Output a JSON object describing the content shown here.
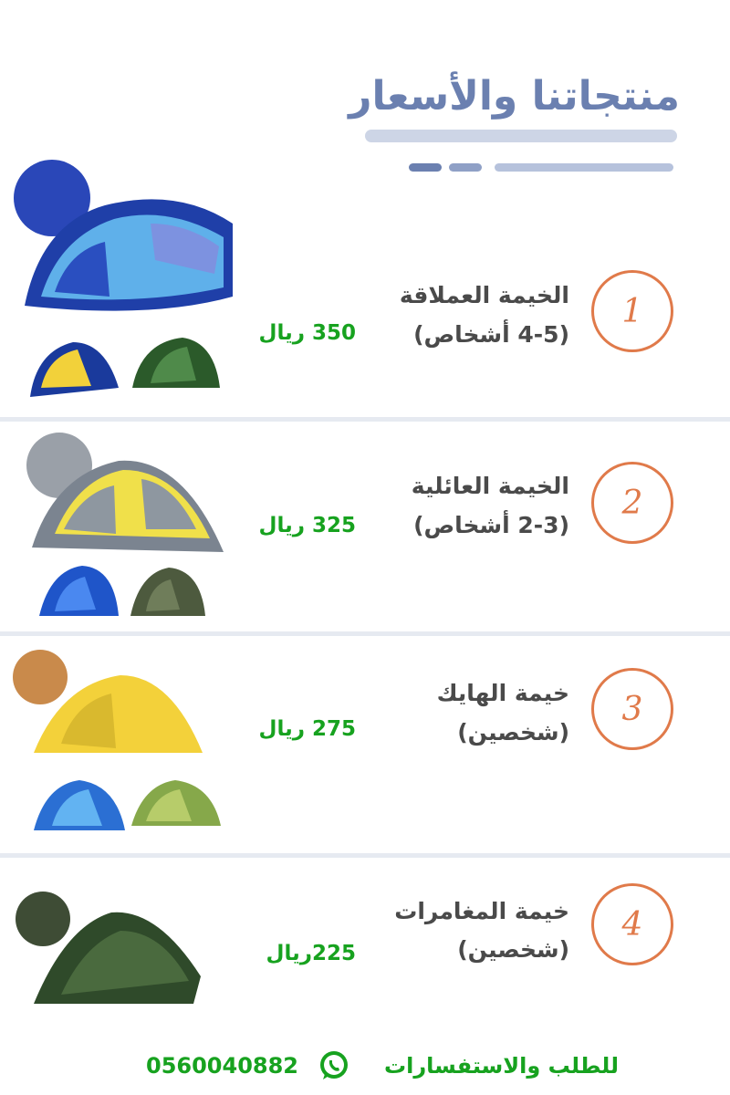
{
  "header": {
    "title": "منتجاتنا والأسعار"
  },
  "products": [
    {
      "number": "1",
      "name": "الخيمة العملاقة",
      "capacity": "(4-5 أشخاص)",
      "price": "350 ريال"
    },
    {
      "number": "2",
      "name": "الخيمة العائلية",
      "capacity": "(2-3 أشخاص)",
      "price": "325 ريال"
    },
    {
      "number": "3",
      "name": "خيمة الهايك",
      "capacity": "(شخصين)",
      "price": "275 ريال"
    },
    {
      "number": "4",
      "name": "خيمة المغامرات",
      "capacity": "(شخصين)",
      "price": "225ريال"
    }
  ],
  "footer": {
    "order_text": "للطلب والاستفسارات",
    "phone": "0560040882",
    "contact_icon": "whatsapp-icon"
  },
  "colors": {
    "title": "#6b80b0",
    "accent_number": "#e07a4a",
    "price_green": "#17a21f",
    "name_text": "#4a4a4a",
    "divider": "#e6eaf1"
  },
  "icons": [
    "tent-image",
    "whatsapp-icon"
  ]
}
